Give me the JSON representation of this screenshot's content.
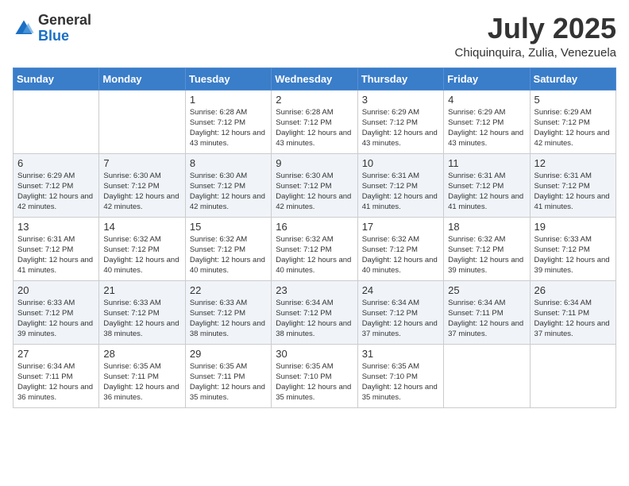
{
  "header": {
    "logo_general": "General",
    "logo_blue": "Blue",
    "month_year": "July 2025",
    "location": "Chiquinquira, Zulia, Venezuela"
  },
  "weekdays": [
    "Sunday",
    "Monday",
    "Tuesday",
    "Wednesday",
    "Thursday",
    "Friday",
    "Saturday"
  ],
  "weeks": [
    [
      {
        "day": "",
        "info": ""
      },
      {
        "day": "",
        "info": ""
      },
      {
        "day": "1",
        "info": "Sunrise: 6:28 AM\nSunset: 7:12 PM\nDaylight: 12 hours and 43 minutes."
      },
      {
        "day": "2",
        "info": "Sunrise: 6:28 AM\nSunset: 7:12 PM\nDaylight: 12 hours and 43 minutes."
      },
      {
        "day": "3",
        "info": "Sunrise: 6:29 AM\nSunset: 7:12 PM\nDaylight: 12 hours and 43 minutes."
      },
      {
        "day": "4",
        "info": "Sunrise: 6:29 AM\nSunset: 7:12 PM\nDaylight: 12 hours and 43 minutes."
      },
      {
        "day": "5",
        "info": "Sunrise: 6:29 AM\nSunset: 7:12 PM\nDaylight: 12 hours and 42 minutes."
      }
    ],
    [
      {
        "day": "6",
        "info": "Sunrise: 6:29 AM\nSunset: 7:12 PM\nDaylight: 12 hours and 42 minutes."
      },
      {
        "day": "7",
        "info": "Sunrise: 6:30 AM\nSunset: 7:12 PM\nDaylight: 12 hours and 42 minutes."
      },
      {
        "day": "8",
        "info": "Sunrise: 6:30 AM\nSunset: 7:12 PM\nDaylight: 12 hours and 42 minutes."
      },
      {
        "day": "9",
        "info": "Sunrise: 6:30 AM\nSunset: 7:12 PM\nDaylight: 12 hours and 42 minutes."
      },
      {
        "day": "10",
        "info": "Sunrise: 6:31 AM\nSunset: 7:12 PM\nDaylight: 12 hours and 41 minutes."
      },
      {
        "day": "11",
        "info": "Sunrise: 6:31 AM\nSunset: 7:12 PM\nDaylight: 12 hours and 41 minutes."
      },
      {
        "day": "12",
        "info": "Sunrise: 6:31 AM\nSunset: 7:12 PM\nDaylight: 12 hours and 41 minutes."
      }
    ],
    [
      {
        "day": "13",
        "info": "Sunrise: 6:31 AM\nSunset: 7:12 PM\nDaylight: 12 hours and 41 minutes."
      },
      {
        "day": "14",
        "info": "Sunrise: 6:32 AM\nSunset: 7:12 PM\nDaylight: 12 hours and 40 minutes."
      },
      {
        "day": "15",
        "info": "Sunrise: 6:32 AM\nSunset: 7:12 PM\nDaylight: 12 hours and 40 minutes."
      },
      {
        "day": "16",
        "info": "Sunrise: 6:32 AM\nSunset: 7:12 PM\nDaylight: 12 hours and 40 minutes."
      },
      {
        "day": "17",
        "info": "Sunrise: 6:32 AM\nSunset: 7:12 PM\nDaylight: 12 hours and 40 minutes."
      },
      {
        "day": "18",
        "info": "Sunrise: 6:32 AM\nSunset: 7:12 PM\nDaylight: 12 hours and 39 minutes."
      },
      {
        "day": "19",
        "info": "Sunrise: 6:33 AM\nSunset: 7:12 PM\nDaylight: 12 hours and 39 minutes."
      }
    ],
    [
      {
        "day": "20",
        "info": "Sunrise: 6:33 AM\nSunset: 7:12 PM\nDaylight: 12 hours and 39 minutes."
      },
      {
        "day": "21",
        "info": "Sunrise: 6:33 AM\nSunset: 7:12 PM\nDaylight: 12 hours and 38 minutes."
      },
      {
        "day": "22",
        "info": "Sunrise: 6:33 AM\nSunset: 7:12 PM\nDaylight: 12 hours and 38 minutes."
      },
      {
        "day": "23",
        "info": "Sunrise: 6:34 AM\nSunset: 7:12 PM\nDaylight: 12 hours and 38 minutes."
      },
      {
        "day": "24",
        "info": "Sunrise: 6:34 AM\nSunset: 7:12 PM\nDaylight: 12 hours and 37 minutes."
      },
      {
        "day": "25",
        "info": "Sunrise: 6:34 AM\nSunset: 7:11 PM\nDaylight: 12 hours and 37 minutes."
      },
      {
        "day": "26",
        "info": "Sunrise: 6:34 AM\nSunset: 7:11 PM\nDaylight: 12 hours and 37 minutes."
      }
    ],
    [
      {
        "day": "27",
        "info": "Sunrise: 6:34 AM\nSunset: 7:11 PM\nDaylight: 12 hours and 36 minutes."
      },
      {
        "day": "28",
        "info": "Sunrise: 6:35 AM\nSunset: 7:11 PM\nDaylight: 12 hours and 36 minutes."
      },
      {
        "day": "29",
        "info": "Sunrise: 6:35 AM\nSunset: 7:11 PM\nDaylight: 12 hours and 35 minutes."
      },
      {
        "day": "30",
        "info": "Sunrise: 6:35 AM\nSunset: 7:10 PM\nDaylight: 12 hours and 35 minutes."
      },
      {
        "day": "31",
        "info": "Sunrise: 6:35 AM\nSunset: 7:10 PM\nDaylight: 12 hours and 35 minutes."
      },
      {
        "day": "",
        "info": ""
      },
      {
        "day": "",
        "info": ""
      }
    ]
  ]
}
